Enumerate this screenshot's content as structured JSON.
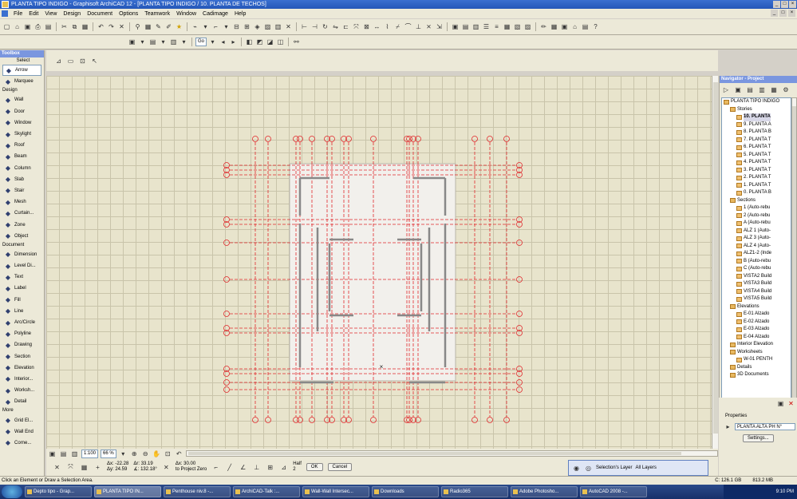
{
  "window": {
    "title": "PLANTA TIPO INDIGO - Graphisoft ArchiCAD 12 - [PLANTA TIPO INDIGO / 10. PLANTA DE TECHOS]",
    "buttons": [
      "_",
      "□",
      "×"
    ]
  },
  "menu": [
    "File",
    "Edit",
    "View",
    "Design",
    "Document",
    "Options",
    "Teamwork",
    "Window",
    "Cadimage",
    "Help"
  ],
  "toolbar2": {
    "go_label": "Go"
  },
  "toolbox": {
    "title": "Toolbox",
    "select_label": "Select",
    "sections": [
      {
        "header": "",
        "items": [
          {
            "label": "Arrow",
            "icon": "arrow-icon",
            "selected": true
          },
          {
            "label": "Marquee",
            "icon": "marquee-icon"
          }
        ]
      },
      {
        "header": "Design",
        "items": [
          {
            "label": "Wall",
            "icon": "wall-icon"
          },
          {
            "label": "Door",
            "icon": "door-icon"
          },
          {
            "label": "Window",
            "icon": "window-icon"
          },
          {
            "label": "Skylight",
            "icon": "skylight-icon"
          },
          {
            "label": "Roof",
            "icon": "roof-icon"
          },
          {
            "label": "Beam",
            "icon": "beam-icon"
          },
          {
            "label": "Column",
            "icon": "column-icon"
          },
          {
            "label": "Slab",
            "icon": "slab-icon"
          },
          {
            "label": "Stair",
            "icon": "stair-icon"
          },
          {
            "label": "Mesh",
            "icon": "mesh-icon"
          },
          {
            "label": "Curtain...",
            "icon": "curtain-wall-icon"
          },
          {
            "label": "Zone",
            "icon": "zone-icon"
          },
          {
            "label": "Object",
            "icon": "object-icon"
          }
        ]
      },
      {
        "header": "Document",
        "items": [
          {
            "label": "Dimension",
            "icon": "dimension-icon"
          },
          {
            "label": "Level Di...",
            "icon": "level-dimension-icon"
          },
          {
            "label": "Text",
            "icon": "text-icon"
          },
          {
            "label": "Label",
            "icon": "label-icon"
          },
          {
            "label": "Fill",
            "icon": "fill-icon"
          },
          {
            "label": "Line",
            "icon": "line-icon"
          },
          {
            "label": "Arc/Circle",
            "icon": "arc-icon"
          },
          {
            "label": "Polyline",
            "icon": "polyline-icon"
          },
          {
            "label": "Drawing",
            "icon": "drawing-icon"
          },
          {
            "label": "Section",
            "icon": "section-icon"
          },
          {
            "label": "Elevation",
            "icon": "elevation-icon"
          },
          {
            "label": "Interior...",
            "icon": "interior-elevation-icon"
          },
          {
            "label": "Worksh...",
            "icon": "worksheet-icon"
          },
          {
            "label": "Detail",
            "icon": "detail-icon"
          }
        ]
      },
      {
        "header": "More",
        "items": [
          {
            "label": "Grid El...",
            "icon": "grid-element-icon"
          },
          {
            "label": "Wall End",
            "icon": "wall-end-icon"
          },
          {
            "label": "Corne...",
            "icon": "corner-window-icon"
          }
        ]
      }
    ]
  },
  "bottom": {
    "scale": "1:100",
    "zoom": "66 %",
    "coords": {
      "dx": "Δx: -22.28",
      "dy": "Δy: 24.59",
      "ar": "Δr: 33.19",
      "aa": "∡: 132.18°",
      "ax": "Δx: 30.00",
      "ref": "to Project Zero",
      "half": "Half",
      "half_val": "2"
    },
    "ok": "OK",
    "cancel": "Cancel",
    "selections_layer": "Selection's Layer",
    "all_layers": "All Layers"
  },
  "navigator": {
    "title": "Navigator - Project",
    "tree": [
      {
        "label": "PLANTA TIPO INDIGO",
        "level": 0
      },
      {
        "label": "Stories",
        "level": 1
      },
      {
        "label": "10. PLANTA",
        "level": 2,
        "selected": true
      },
      {
        "label": "9. PLANTA A",
        "level": 2
      },
      {
        "label": "8. PLANTA B",
        "level": 2
      },
      {
        "label": "7. PLANTA T",
        "level": 2
      },
      {
        "label": "6. PLANTA T",
        "level": 2
      },
      {
        "label": "5. PLANTA T",
        "level": 2
      },
      {
        "label": "4. PLANTA T",
        "level": 2
      },
      {
        "label": "3. PLANTA T",
        "level": 2
      },
      {
        "label": "2. PLANTA T",
        "level": 2
      },
      {
        "label": "1. PLANTA T",
        "level": 2
      },
      {
        "label": "0. PLANTA B",
        "level": 2
      },
      {
        "label": "Sections",
        "level": 1
      },
      {
        "label": "1 (Auto-rebu",
        "level": 2
      },
      {
        "label": "2 (Auto-rebu",
        "level": 2
      },
      {
        "label": "A (Auto-rebu",
        "level": 2
      },
      {
        "label": "ALZ 1 (Auto-",
        "level": 2
      },
      {
        "label": "ALZ 3 (Auto-",
        "level": 2
      },
      {
        "label": "ALZ 4 (Auto-",
        "level": 2
      },
      {
        "label": "ALZ1-2 (Inde",
        "level": 2
      },
      {
        "label": "B (Auto-rebu",
        "level": 2
      },
      {
        "label": "C (Auto-rebu",
        "level": 2
      },
      {
        "label": "VISTA2 Build",
        "level": 2
      },
      {
        "label": "VISTA3 Build",
        "level": 2
      },
      {
        "label": "VISTA4 Build",
        "level": 2
      },
      {
        "label": "VISTA5 Build",
        "level": 2
      },
      {
        "label": "Elevations",
        "level": 1
      },
      {
        "label": "E-01 Alzado",
        "level": 2
      },
      {
        "label": "E-02 Alzado",
        "level": 2
      },
      {
        "label": "E-03 Alzado",
        "level": 2
      },
      {
        "label": "E-04 Alzado",
        "level": 2
      },
      {
        "label": "Interior Elevation",
        "level": 1
      },
      {
        "label": "Worksheets",
        "level": 1
      },
      {
        "label": "W-01 PENTH",
        "level": 2
      },
      {
        "label": "Details",
        "level": 1
      },
      {
        "label": "3D Documents",
        "level": 1
      }
    ],
    "properties_label": "Properties",
    "properties_value": "PLANTA ALTA PH N°",
    "settings_button": "Settings..."
  },
  "status": {
    "hint": "Click an Element or Draw a Selection Area.",
    "disk": "C: 126.1 GB",
    "memory": "813.2 MB"
  },
  "taskbar": {
    "tasks": [
      {
        "label": "Depto tipo - Grap...",
        "active": false
      },
      {
        "label": "PLANTA TIPO IN...",
        "active": true
      },
      {
        "label": "Penthouse niv.8 -...",
        "active": false
      },
      {
        "label": "ArchiCAD-Talk :...",
        "active": false
      },
      {
        "label": "Wall-Wall Intersec...",
        "active": false
      },
      {
        "label": "Downloads",
        "active": false
      },
      {
        "label": "Radio365",
        "active": false
      },
      {
        "label": "Adobe Photosho...",
        "active": false
      },
      {
        "label": "AutoCAD 2008 -...",
        "active": false
      }
    ],
    "clock": "9:10 PM"
  },
  "plan": {
    "grid_color": "#e0282c",
    "wall_color": "#888888",
    "slab_color": "#f2f0ec"
  }
}
